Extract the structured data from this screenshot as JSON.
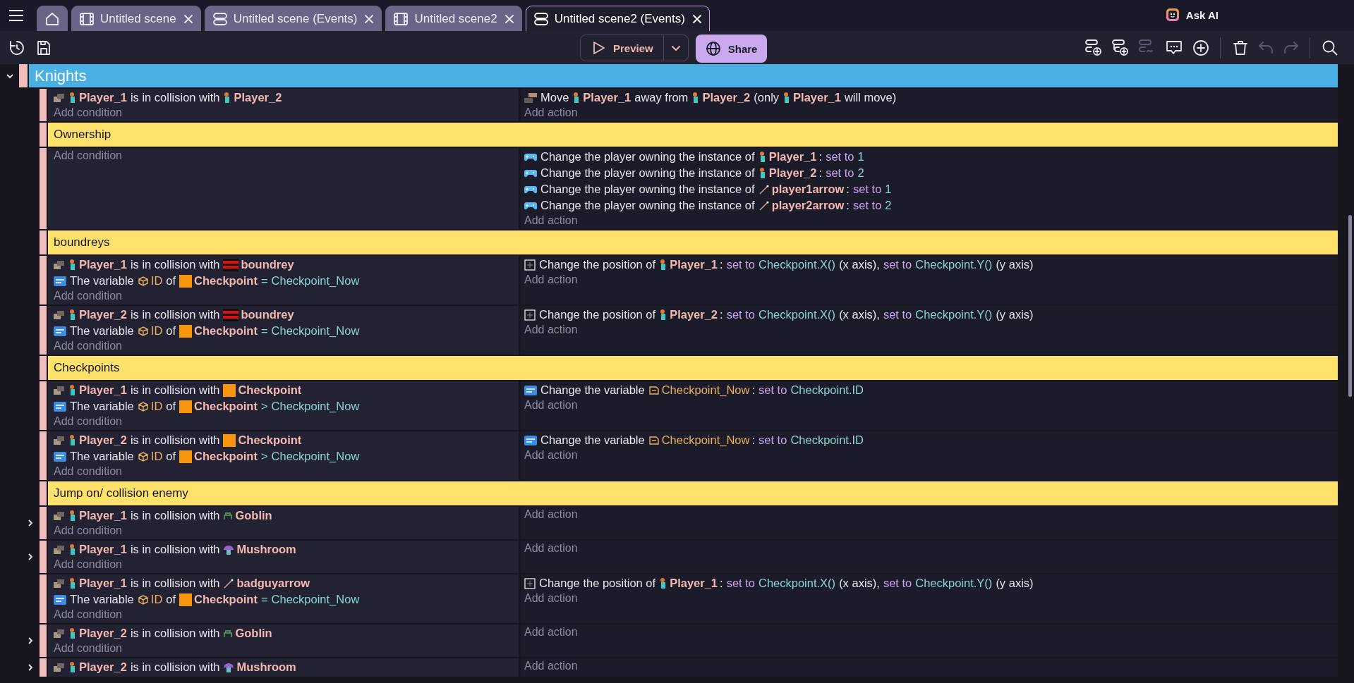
{
  "tabs": [
    {
      "kind": "home",
      "selected": false
    },
    {
      "kind": "scene",
      "label": "Untitled scene",
      "selected": false
    },
    {
      "kind": "events",
      "label": "Untitled scene (Events)",
      "selected": false
    },
    {
      "kind": "scene",
      "label": "Untitled scene2",
      "selected": false
    },
    {
      "kind": "events",
      "label": "Untitled scene2 (Events)",
      "selected": true
    }
  ],
  "ask_ai": {
    "label": "Ask AI"
  },
  "toolbar": {
    "left": [
      {
        "kind": "history"
      },
      {
        "kind": "save"
      }
    ],
    "preview": {
      "label": "Preview"
    },
    "share": {
      "label": "Share"
    },
    "right": [
      {
        "kind": "add-event",
        "disabled": false
      },
      {
        "kind": "add-subevent",
        "disabled": false
      },
      {
        "kind": "add-other",
        "disabled": true
      },
      {
        "kind": "comment",
        "disabled": false
      },
      {
        "kind": "add",
        "disabled": false
      },
      {
        "kind": "separator"
      },
      {
        "kind": "delete",
        "disabled": false
      },
      {
        "kind": "undo",
        "disabled": true
      },
      {
        "kind": "redo",
        "disabled": true
      },
      {
        "kind": "separator"
      },
      {
        "kind": "search",
        "disabled": false
      }
    ]
  },
  "events": [
    {
      "kind": "group",
      "title": "Knights",
      "expanded": true,
      "children": [
        {
          "kind": "event",
          "conditions": [
            {
              "kind": "collision",
              "parts": [
                {
                  "kind": "character",
                  "text": "Player_1"
                },
                {
                  "kind": "text",
                  "text": "is in collision with"
                },
                {
                  "kind": "character",
                  "text": "Player_2"
                }
              ]
            }
          ],
          "add_condition": "Add condition",
          "actions": [
            {
              "kind": "move",
              "parts": [
                {
                  "kind": "text",
                  "text": "Move"
                },
                {
                  "kind": "character",
                  "text": "Player_1"
                },
                {
                  "kind": "text",
                  "text": "away from"
                },
                {
                  "kind": "character",
                  "text": "Player_2"
                },
                {
                  "kind": "text",
                  "text": "(only"
                },
                {
                  "kind": "character",
                  "text": "Player_1"
                },
                {
                  "kind": "text",
                  "text": "will move)"
                }
              ]
            }
          ],
          "add_action": "Add action"
        },
        {
          "kind": "comment",
          "text": "Ownership"
        },
        {
          "kind": "event",
          "add_condition": "Add condition",
          "actions": [
            {
              "kind": "multiplayer",
              "parts": [
                {
                  "kind": "text",
                  "text": "Change the player owning the instance of"
                },
                {
                  "kind": "character",
                  "text": "Player_1",
                  "after": ":"
                },
                {
                  "kind": "op",
                  "text": "set to"
                },
                {
                  "kind": "value",
                  "text": "1"
                }
              ]
            },
            {
              "kind": "multiplayer",
              "parts": [
                {
                  "kind": "text",
                  "text": "Change the player owning the instance of"
                },
                {
                  "kind": "character",
                  "text": "Player_2",
                  "after": ":"
                },
                {
                  "kind": "op",
                  "text": "set to"
                },
                {
                  "kind": "value",
                  "text": "2"
                }
              ]
            },
            {
              "kind": "multiplayer",
              "parts": [
                {
                  "kind": "text",
                  "text": "Change the player owning the instance of"
                },
                {
                  "kind": "arrow",
                  "text": "player1arrow",
                  "after": ":"
                },
                {
                  "kind": "op",
                  "text": "set to"
                },
                {
                  "kind": "value",
                  "text": "1"
                }
              ]
            },
            {
              "kind": "multiplayer",
              "parts": [
                {
                  "kind": "text",
                  "text": "Change the player owning the instance of"
                },
                {
                  "kind": "arrow",
                  "text": "player2arrow",
                  "after": ":"
                },
                {
                  "kind": "op",
                  "text": "set to"
                },
                {
                  "kind": "value",
                  "text": "2"
                }
              ]
            }
          ],
          "add_action": "Add action"
        },
        {
          "kind": "comment",
          "text": "boundreys"
        },
        {
          "kind": "event",
          "conditions": [
            {
              "kind": "collision",
              "parts": [
                {
                  "kind": "character",
                  "text": "Player_1"
                },
                {
                  "kind": "text",
                  "text": "is in collision with"
                },
                {
                  "kind": "wall",
                  "text": "boundrey"
                }
              ]
            },
            {
              "kind": "variable",
              "parts": [
                {
                  "kind": "text",
                  "text": "The variable"
                },
                {
                  "kind": "objvar",
                  "text": "ID"
                },
                {
                  "kind": "text",
                  "text": "of"
                },
                {
                  "kind": "square",
                  "text": "Checkpoint"
                },
                {
                  "kind": "value",
                  "text": "="
                },
                {
                  "kind": "value",
                  "text": "Checkpoint_Now"
                }
              ]
            }
          ],
          "add_condition": "Add condition",
          "actions": [
            {
              "kind": "position",
              "parts": [
                {
                  "kind": "text",
                  "text": "Change the position of"
                },
                {
                  "kind": "character",
                  "text": "Player_1",
                  "after": ":"
                },
                {
                  "kind": "op",
                  "text": "set to"
                },
                {
                  "kind": "value",
                  "text": "Checkpoint.X()"
                },
                {
                  "kind": "text",
                  "text": "(x axis),"
                },
                {
                  "kind": "op",
                  "text": "set to"
                },
                {
                  "kind": "value",
                  "text": "Checkpoint.Y()"
                },
                {
                  "kind": "text",
                  "text": "(y axis)"
                }
              ]
            }
          ],
          "add_action": "Add action"
        },
        {
          "kind": "event",
          "conditions": [
            {
              "kind": "collision",
              "parts": [
                {
                  "kind": "character",
                  "text": "Player_2"
                },
                {
                  "kind": "text",
                  "text": "is in collision with"
                },
                {
                  "kind": "wall",
                  "text": "boundrey"
                }
              ]
            },
            {
              "kind": "variable",
              "parts": [
                {
                  "kind": "text",
                  "text": "The variable"
                },
                {
                  "kind": "objvar",
                  "text": "ID"
                },
                {
                  "kind": "text",
                  "text": "of"
                },
                {
                  "kind": "square",
                  "text": "Checkpoint"
                },
                {
                  "kind": "value",
                  "text": "="
                },
                {
                  "kind": "value",
                  "text": "Checkpoint_Now"
                }
              ]
            }
          ],
          "add_condition": "Add condition",
          "actions": [
            {
              "kind": "position",
              "parts": [
                {
                  "kind": "text",
                  "text": "Change the position of"
                },
                {
                  "kind": "character",
                  "text": "Player_2",
                  "after": ":"
                },
                {
                  "kind": "op",
                  "text": "set to"
                },
                {
                  "kind": "value",
                  "text": "Checkpoint.X()"
                },
                {
                  "kind": "text",
                  "text": "(x axis),"
                },
                {
                  "kind": "op",
                  "text": "set to"
                },
                {
                  "kind": "value",
                  "text": "Checkpoint.Y()"
                },
                {
                  "kind": "text",
                  "text": "(y axis)"
                }
              ]
            }
          ],
          "add_action": "Add action"
        },
        {
          "kind": "comment",
          "text": "Checkpoints"
        },
        {
          "kind": "event",
          "conditions": [
            {
              "kind": "collision",
              "parts": [
                {
                  "kind": "character",
                  "text": "Player_1"
                },
                {
                  "kind": "text",
                  "text": "is in collision with"
                },
                {
                  "kind": "square",
                  "text": "Checkpoint"
                }
              ]
            },
            {
              "kind": "variable",
              "parts": [
                {
                  "kind": "text",
                  "text": "The variable"
                },
                {
                  "kind": "objvar",
                  "text": "ID"
                },
                {
                  "kind": "text",
                  "text": "of"
                },
                {
                  "kind": "square",
                  "text": "Checkpoint"
                },
                {
                  "kind": "value",
                  "text": ">"
                },
                {
                  "kind": "value",
                  "text": "Checkpoint_Now"
                }
              ]
            }
          ],
          "add_condition": "Add condition",
          "actions": [
            {
              "kind": "variable",
              "parts": [
                {
                  "kind": "text",
                  "text": "Change the variable"
                },
                {
                  "kind": "scenevar",
                  "text": "Checkpoint_Now",
                  "after": ":"
                },
                {
                  "kind": "op",
                  "text": "set to"
                },
                {
                  "kind": "value",
                  "text": "Checkpoint.ID"
                }
              ]
            }
          ],
          "add_action": "Add action"
        },
        {
          "kind": "event",
          "conditions": [
            {
              "kind": "collision",
              "parts": [
                {
                  "kind": "character",
                  "text": "Player_2"
                },
                {
                  "kind": "text",
                  "text": "is in collision with"
                },
                {
                  "kind": "square",
                  "text": "Checkpoint"
                }
              ]
            },
            {
              "kind": "variable",
              "parts": [
                {
                  "kind": "text",
                  "text": "The variable"
                },
                {
                  "kind": "objvar",
                  "text": "ID"
                },
                {
                  "kind": "text",
                  "text": "of"
                },
                {
                  "kind": "square",
                  "text": "Checkpoint"
                },
                {
                  "kind": "value",
                  "text": ">"
                },
                {
                  "kind": "value",
                  "text": "Checkpoint_Now"
                }
              ]
            }
          ],
          "add_condition": "Add condition",
          "actions": [
            {
              "kind": "variable",
              "parts": [
                {
                  "kind": "text",
                  "text": "Change the variable"
                },
                {
                  "kind": "scenevar",
                  "text": "Checkpoint_Now",
                  "after": ":"
                },
                {
                  "kind": "op",
                  "text": "set to"
                },
                {
                  "kind": "value",
                  "text": "Checkpoint.ID"
                }
              ]
            }
          ],
          "add_action": "Add action"
        },
        {
          "kind": "comment",
          "text": "Jump on/ collision enemy"
        },
        {
          "kind": "event",
          "expanded": false,
          "conditions": [
            {
              "kind": "collision",
              "parts": [
                {
                  "kind": "character",
                  "text": "Player_1"
                },
                {
                  "kind": "text",
                  "text": "is in collision with"
                },
                {
                  "kind": "goblin",
                  "text": "Goblin"
                }
              ]
            }
          ],
          "add_condition": "Add condition",
          "add_action": "Add action"
        },
        {
          "kind": "event",
          "expanded": false,
          "conditions": [
            {
              "kind": "collision",
              "parts": [
                {
                  "kind": "character",
                  "text": "Player_1"
                },
                {
                  "kind": "text",
                  "text": "is in collision with"
                },
                {
                  "kind": "mushroom",
                  "text": "Mushroom"
                }
              ]
            }
          ],
          "add_condition": "Add condition",
          "add_action": "Add action"
        },
        {
          "kind": "event",
          "conditions": [
            {
              "kind": "collision",
              "parts": [
                {
                  "kind": "character",
                  "text": "Player_1"
                },
                {
                  "kind": "text",
                  "text": "is in collision with"
                },
                {
                  "kind": "arrow",
                  "text": "badguyarrow"
                }
              ]
            },
            {
              "kind": "variable",
              "parts": [
                {
                  "kind": "text",
                  "text": "The variable"
                },
                {
                  "kind": "objvar",
                  "text": "ID"
                },
                {
                  "kind": "text",
                  "text": "of"
                },
                {
                  "kind": "square",
                  "text": "Checkpoint"
                },
                {
                  "kind": "value",
                  "text": "="
                },
                {
                  "kind": "value",
                  "text": "Checkpoint_Now"
                }
              ]
            }
          ],
          "add_condition": "Add condition",
          "actions": [
            {
              "kind": "position",
              "parts": [
                {
                  "kind": "text",
                  "text": "Change the position of"
                },
                {
                  "kind": "character",
                  "text": "Player_1",
                  "after": ":"
                },
                {
                  "kind": "op",
                  "text": "set to"
                },
                {
                  "kind": "value",
                  "text": "Checkpoint.X()"
                },
                {
                  "kind": "text",
                  "text": "(x axis),"
                },
                {
                  "kind": "op",
                  "text": "set to"
                },
                {
                  "kind": "value",
                  "text": "Checkpoint.Y()"
                },
                {
                  "kind": "text",
                  "text": "(y axis)"
                }
              ]
            }
          ],
          "add_action": "Add action"
        },
        {
          "kind": "event",
          "expanded": false,
          "conditions": [
            {
              "kind": "collision",
              "parts": [
                {
                  "kind": "character",
                  "text": "Player_2"
                },
                {
                  "kind": "text",
                  "text": "is in collision with"
                },
                {
                  "kind": "goblin",
                  "text": "Goblin"
                }
              ]
            }
          ],
          "add_condition": "Add condition",
          "add_action": "Add action"
        },
        {
          "kind": "event",
          "expanded": false,
          "conditions": [
            {
              "kind": "collision",
              "parts": [
                {
                  "kind": "character",
                  "text": "Player_2"
                },
                {
                  "kind": "text",
                  "text": "is in collision with"
                },
                {
                  "kind": "mushroom",
                  "text": "Mushroom"
                }
              ]
            }
          ],
          "add_action": "Add action"
        }
      ]
    }
  ]
}
